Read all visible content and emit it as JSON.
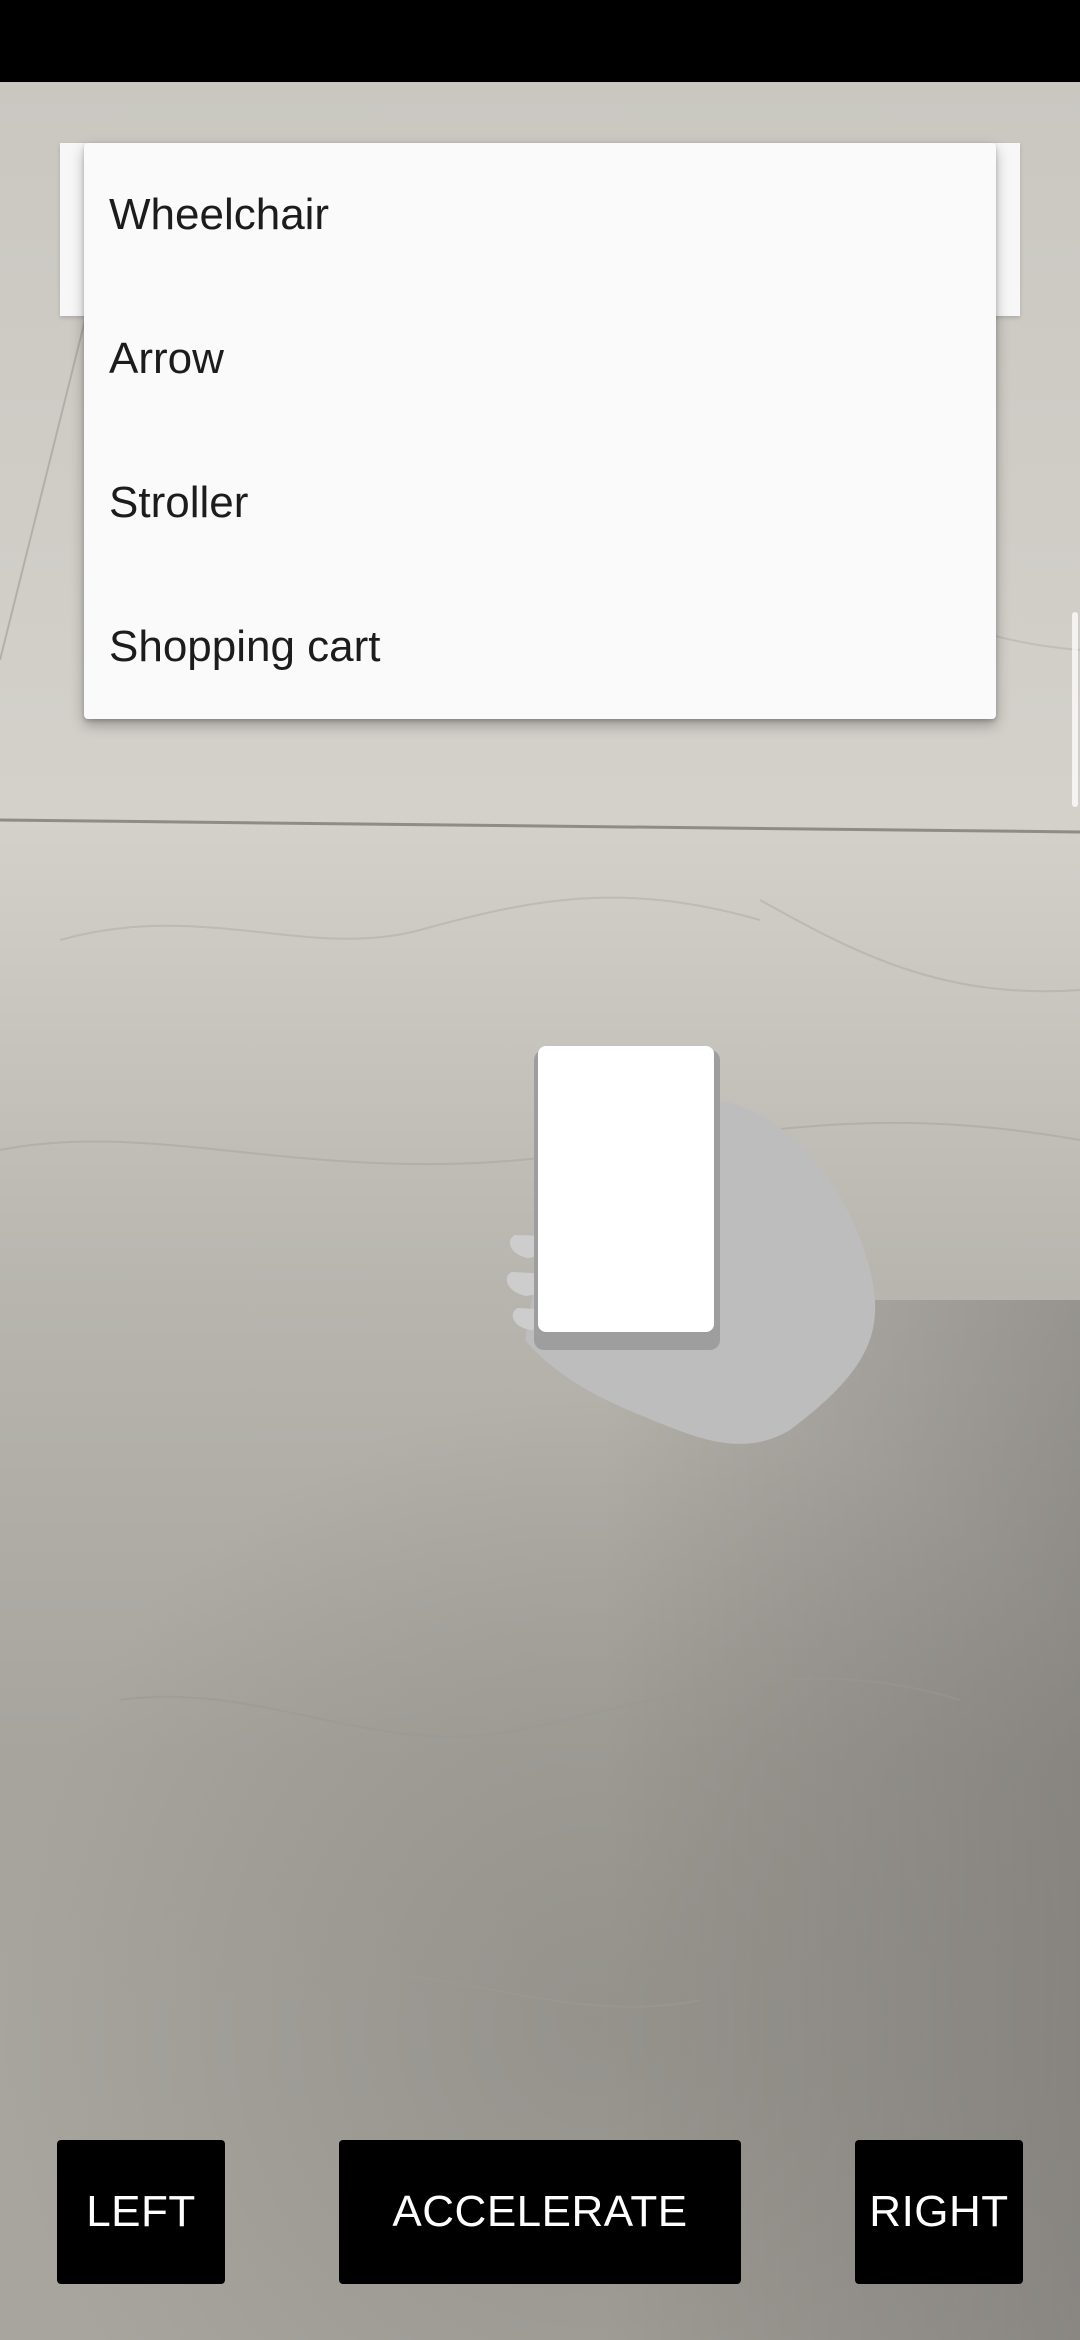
{
  "dropdown": {
    "options": [
      "Wheelchair",
      "Arrow",
      "Stroller",
      "Shopping cart"
    ]
  },
  "controls": {
    "left_label": "LEFT",
    "accelerate_label": "ACCELERATE",
    "right_label": "RIGHT"
  },
  "icons": {
    "ar_placement_hint": "hand-holding-phone-icon"
  },
  "colors": {
    "button_bg": "#000000",
    "button_text": "#ffffff",
    "dropdown_bg": "#fafafa"
  }
}
